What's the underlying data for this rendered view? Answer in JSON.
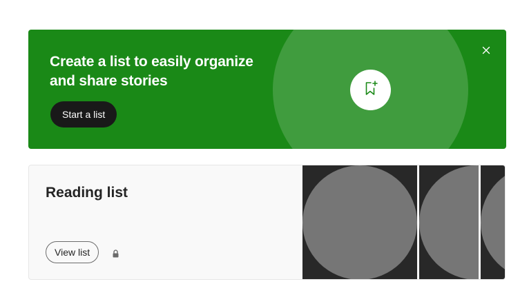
{
  "promo": {
    "title": "Create a list to easily organize and share stories",
    "start_label": "Start a list",
    "bookmark_icon": "bookmark-add-icon",
    "close_icon": "close-icon",
    "accent_color": "#1a8917"
  },
  "reading_list": {
    "title": "Reading list",
    "view_label": "View list",
    "privacy_icon": "lock-icon",
    "preview_count": 3
  }
}
